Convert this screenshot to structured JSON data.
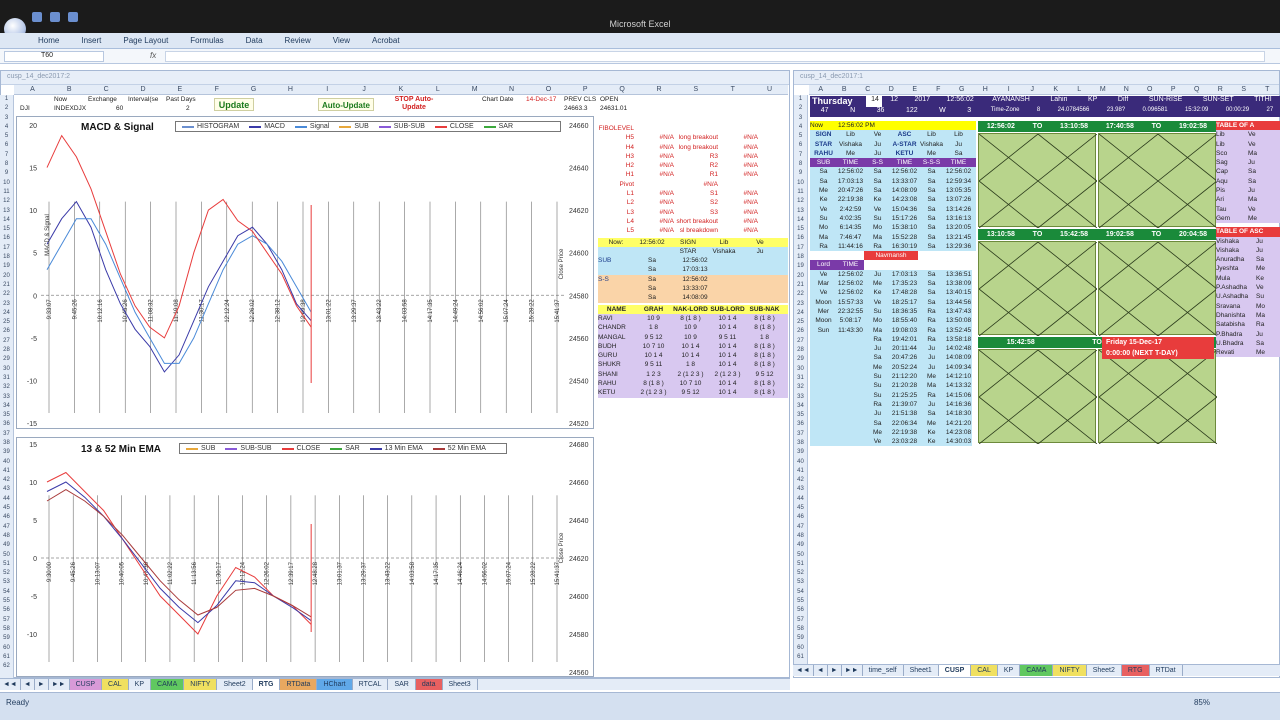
{
  "app": {
    "title": "Microsoft Excel",
    "name_box": "T60",
    "fx_label": "fx",
    "ribbon_tabs": [
      "Home",
      "Insert",
      "Page Layout",
      "Formulas",
      "Data",
      "Review",
      "View",
      "Acrobat"
    ]
  },
  "left_window": {
    "caption": "cusp_14_dec2017:2",
    "columns": [
      "A",
      "B",
      "C",
      "D",
      "E",
      "F",
      "G",
      "H",
      "I",
      "J",
      "K",
      "L",
      "M",
      "N",
      "O",
      "P",
      "Q",
      "R",
      "S",
      "T",
      "U"
    ],
    "header_row": {
      "now": "Now",
      "exchange": "Exchange",
      "interval": "Interval(se",
      "past_days": "Past Days",
      "dji": "DJI",
      "indexdjx": "INDEXDJX",
      "interval_val": "60",
      "past_val": "2",
      "chart_date_label": "Chart Date",
      "chart_date": "14-Dec-17",
      "prev_cls": "PREV CLS",
      "open": "OPEN",
      "prev_cls_val": "24663.3",
      "open_val": "24631.01"
    },
    "buttons": {
      "update": "Update",
      "auto_update": "Auto-Update",
      "stop_auto": "STOP Auto-Update"
    }
  },
  "chart_data": [
    {
      "type": "line",
      "title": "MACD & Signal",
      "legend": [
        "HISTOGRAM",
        "MACD",
        "Signal",
        "SUB",
        "SUB-SUB",
        "CLOSE",
        "SAR"
      ],
      "ylabel": "MACD & Signal",
      "y2label": "Close Price",
      "ylim": [
        -15,
        20
      ],
      "y_ticks": [
        20,
        15,
        10,
        5,
        0,
        -5,
        -10,
        -15
      ],
      "y2lim": [
        24520,
        24660
      ],
      "y2_ticks": [
        24660,
        24640,
        24620,
        24600,
        24580,
        24560,
        24540,
        24520
      ],
      "x_ticks": [
        "9:33:07",
        "9:45:26",
        "10:12:16",
        "10:45:26",
        "11:08:32",
        "11:19:08",
        "11:30:17",
        "12:12:24",
        "12:26:02",
        "12:38:12",
        "12:49:38",
        "13:01:22",
        "13:29:37",
        "13:43:22",
        "14:03:58",
        "14:17:35",
        "14:49:24",
        "14:56:02",
        "15:07:24",
        "15:28:22",
        "15:41:37"
      ],
      "series": [
        {
          "name": "MACD",
          "color": "#3a3aa8",
          "values": [
            6,
            9,
            11,
            8,
            3,
            -1,
            -4,
            -6,
            -9,
            -7,
            -3,
            1,
            4,
            7,
            8,
            6,
            3,
            -1,
            -3
          ]
        },
        {
          "name": "Signal",
          "color": "#4a8ad8",
          "values": [
            3,
            6,
            9,
            9,
            6,
            2,
            -2,
            -5,
            -8,
            -8,
            -5,
            -1,
            3,
            6,
            7,
            6,
            4,
            1,
            -2
          ]
        },
        {
          "name": "CLOSE",
          "color": "#e83c3c",
          "values": [
            24640,
            24655,
            24645,
            24630,
            24610,
            24590,
            24575,
            24565,
            24560,
            24575,
            24600,
            24620,
            24625,
            24615,
            24610,
            24600,
            24590,
            24575,
            24565
          ]
        }
      ]
    },
    {
      "type": "line",
      "title": "13 & 52 Min EMA",
      "legend": [
        "SUB",
        "SUB-SUB",
        "CLOSE",
        "SAR",
        "13 Min EMA",
        "52 Min EMA"
      ],
      "ylabel": "",
      "y2label": "Close Price",
      "ylim": [
        -15,
        15
      ],
      "y_ticks": [
        15,
        10,
        5,
        0,
        -5,
        -10
      ],
      "y2lim": [
        24560,
        24680
      ],
      "y2_ticks": [
        24680,
        24660,
        24640,
        24620,
        24600,
        24580,
        24560
      ],
      "x_ticks": [
        "9:30:00",
        "9:45:26",
        "10:13:07",
        "10:40:05",
        "10:47:36",
        "11:02:22",
        "11:13:56",
        "11:30:17",
        "12:12:24",
        "12:26:02",
        "12:39:17",
        "12:48:28",
        "13:01:37",
        "13:29:37",
        "13:43:22",
        "14:03:58",
        "14:17:35",
        "14:46:24",
        "14:56:02",
        "15:07:24",
        "15:28:22",
        "15:41:37"
      ],
      "series": [
        {
          "name": "CLOSE",
          "color": "#e83c3c",
          "values": [
            24660,
            24665,
            24655,
            24645,
            24630,
            24615,
            24600,
            24590,
            24580,
            24600,
            24615,
            24610,
            24600,
            24595,
            24585
          ]
        },
        {
          "name": "13 Min EMA",
          "color": "#3a3aa8",
          "values": [
            24655,
            24660,
            24652,
            24642,
            24630,
            24617,
            24604,
            24594,
            24586,
            24595,
            24608,
            24607,
            24600,
            24594,
            24587
          ]
        },
        {
          "name": "52 Min EMA",
          "color": "#a83a3a",
          "values": [
            24650,
            24656,
            24650,
            24642,
            24632,
            24620,
            24608,
            24598,
            24590,
            24594,
            24603,
            24604,
            24600,
            24595,
            24589
          ]
        }
      ]
    }
  ],
  "pivot_panel": {
    "rows": [
      {
        "label": "FIBOLEVEL",
        "a": "",
        "b": "",
        "c": ""
      },
      {
        "label": "H5",
        "a": "#N/A",
        "b": "long breakout",
        "c": "#N/A"
      },
      {
        "label": "H4",
        "a": "#N/A",
        "b": "long breakout",
        "c": "#N/A"
      },
      {
        "label": "H3",
        "a": "#N/A",
        "b": "R3",
        "c": "#N/A"
      },
      {
        "label": "H2",
        "a": "#N/A",
        "b": "R2",
        "c": "#N/A"
      },
      {
        "label": "H1",
        "a": "#N/A",
        "b": "R1",
        "c": "#N/A"
      },
      {
        "label": "Pivot",
        "a": "",
        "b": "#N/A",
        "c": ""
      },
      {
        "label": "L1",
        "a": "#N/A",
        "b": "S1",
        "c": "#N/A"
      },
      {
        "label": "L2",
        "a": "#N/A",
        "b": "S2",
        "c": "#N/A"
      },
      {
        "label": "L3",
        "a": "#N/A",
        "b": "S3",
        "c": "#N/A"
      },
      {
        "label": "L4",
        "a": "#N/A",
        "b": "short breakout",
        "c": "#N/A"
      },
      {
        "label": "L5",
        "a": "#N/A",
        "b": "sl breakdown",
        "c": "#N/A"
      }
    ],
    "now_row": {
      "label": "Now:",
      "time": "12:56:02",
      "sign": "SIGN",
      "lib": "Lib",
      "ve": "Ve"
    },
    "star_row": {
      "star": "STAR",
      "vishaka": "Vishaka",
      "ju": "Ju"
    },
    "sub_rows": [
      {
        "label": "SUB",
        "a": "Sa",
        "b": "12:56:02"
      },
      {
        "label": "",
        "a": "Sa",
        "b": "17:03:13"
      },
      {
        "label": "S-S",
        "a": "Sa",
        "b": "12:56:02"
      },
      {
        "label": "",
        "a": "Sa",
        "b": "13:33:07"
      },
      {
        "label": "",
        "a": "Sa",
        "b": "14:08:09"
      }
    ],
    "planet_header": [
      "NAME",
      "GRAH",
      "NAK-LORD",
      "SUB-LORD",
      "SUB-NAK"
    ],
    "planets": [
      [
        "RAVI",
        "10 9",
        "8 (1 8 )",
        "10 1 4",
        "8 (1 8 )"
      ],
      [
        "CHANDR",
        "1 8",
        "10 9",
        "10 1 4",
        "8 (1 8 )"
      ],
      [
        "MANGAL",
        "9 5 12",
        "10 9",
        "9 5 11",
        "1 8"
      ],
      [
        "BUDH",
        "10 7 10",
        "10 1 4",
        "10 1 4",
        "8 (1 8 )"
      ],
      [
        "GURU",
        "10 1 4",
        "10 1 4",
        "10 1 4",
        "8 (1 8 )"
      ],
      [
        "SHUKR",
        "9 5 11",
        "1 8",
        "10 1 4",
        "8 (1 8 )"
      ],
      [
        "SHANI",
        "1 2 3",
        "2 (1 2 3 )",
        "2 (1 2 3 )",
        "9 5 12"
      ],
      [
        "RAHU",
        "8 (1 8 )",
        "10 7 10",
        "10 1 4",
        "8 (1 8 )"
      ],
      [
        "KETU",
        "2 (1 2 3 )",
        "9 5 12",
        "10 1 4",
        "8 (1 8 )"
      ]
    ]
  },
  "left_sheet_tabs": [
    "CUSP",
    "CAL",
    "KP",
    "CAMA",
    "NIFTY",
    "Sheet2",
    "RTG",
    "RTData",
    "HChart",
    "RTCAL",
    "SAR",
    "data",
    "Sheet3"
  ],
  "right_window": {
    "caption": "cusp_14_dec2017:1",
    "columns": [
      "A",
      "B",
      "C",
      "D",
      "E",
      "F",
      "G",
      "H",
      "I",
      "J",
      "K",
      "L",
      "M",
      "N",
      "O",
      "P",
      "Q",
      "R",
      "S",
      "T"
    ],
    "header": {
      "day": "Thursday",
      "d": "14",
      "m": "12",
      "y": "2017",
      "time": "12:56:02",
      "ayanansh": "AYANANSH",
      "lahiri": "Lahiri",
      "kp": "KP",
      "diff": "Diff",
      "sunrise": "SUN-RISE",
      "sunset": "SUN-SET",
      "tithi": "TITHI",
      "lat": "47",
      "n": "N",
      "deg": "36",
      "long": "122",
      "w": "W",
      "tz_val": "3",
      "tz": "Time-Zone",
      "tz_num": "8",
      "lahiri_val": "24.0784566",
      "kp_val": "23.98?",
      "diff_val": "0.096581",
      "sunrise_val": "15:32:09",
      "sunset_val": "00:00:29",
      "tithi_val": "27",
      "now": "Now",
      "now_time": "12:56:02 PM",
      "table_of": "TABLE OF A"
    },
    "sign_block": [
      [
        "SIGN",
        "Lib",
        "Ve",
        "ASC",
        "Lib",
        "Lib"
      ],
      [
        "STAR",
        "Vishaka",
        "Ju",
        "A-STAR",
        "Vishaka",
        "Ju"
      ],
      [
        "RAHU",
        "Me",
        "Ju",
        "KETU",
        "Me",
        "Sa"
      ]
    ],
    "sub_block_header": [
      "SUB",
      "TIME",
      "S-S",
      "TIME",
      "S-S-S",
      "TIME"
    ],
    "sub_block": [
      [
        "Sa",
        "12:56:02",
        "Sa",
        "12:56:02",
        "Sa",
        "12:56:02"
      ],
      [
        "Sa",
        "17:03:13",
        "Sa",
        "13:33:07",
        "Sa",
        "12:59:34"
      ],
      [
        "Me",
        "20:47:26",
        "Sa",
        "14:08:09",
        "Sa",
        "13:05:35"
      ],
      [
        "Ke",
        "22:19:38",
        "Ke",
        "14:23:08",
        "Sa",
        "13:07:26"
      ],
      [
        "Ve",
        "2:42:59",
        "Ve",
        "15:04:36",
        "Sa",
        "13:14:26"
      ],
      [
        "Su",
        "4:02:35",
        "Su",
        "15:17:26",
        "Sa",
        "13:16:13"
      ],
      [
        "Mo",
        "6:14:35",
        "Mo",
        "15:38:10",
        "Sa",
        "13:20:05"
      ],
      [
        "Ma",
        "7:46:47",
        "Ma",
        "15:52:28",
        "Sa",
        "13:21:45"
      ],
      [
        "Ra",
        "11:44:16",
        "Ra",
        "16:30:19",
        "Sa",
        "13:29:36"
      ]
    ],
    "navmansh": "Navmansh",
    "lord_header": [
      "Lord",
      "TIME"
    ],
    "lord_block": [
      [
        "Ve",
        "12:56:02",
        "Ju",
        "17:03:13",
        "Sa",
        "13:36:51"
      ],
      [
        "Mar",
        "12:56:02",
        "Me",
        "17:35:23",
        "Sa",
        "13:38:09"
      ],
      [
        "Ve",
        "12:56:02",
        "Ke",
        "17:48:28",
        "Sa",
        "13:40:15"
      ],
      [
        "Moon",
        "15:57:33",
        "Ve",
        "18:25:17",
        "Sa",
        "13:44:56"
      ],
      [
        "Mer",
        "22:32:55",
        "Su",
        "18:36:35",
        "Ra",
        "13:47:43"
      ],
      [
        "Moon",
        "5:08:17",
        "Mo",
        "18:55:40",
        "Ra",
        "13:50:08"
      ],
      [
        "Sun",
        "11:43:30",
        "Ma",
        "19:08:03",
        "Ra",
        "13:52:45"
      ],
      [
        "",
        "",
        "Ra",
        "19:42:01",
        "Ra",
        "13:58:18"
      ],
      [
        "",
        "",
        "Ju",
        "20:11:44",
        "Ju",
        "14:02:48"
      ],
      [
        "",
        "",
        "Sa",
        "20:47:26",
        "Ju",
        "14:08:09"
      ],
      [
        "",
        "",
        "Me",
        "20:52:24",
        "Ju",
        "14:09:34"
      ],
      [
        "",
        "",
        "Su",
        "21:12:20",
        "Me",
        "14:12:10"
      ],
      [
        "",
        "",
        "Su",
        "21:20:28",
        "Ma",
        "14:13:32"
      ],
      [
        "",
        "",
        "Su",
        "21:25:25",
        "Ra",
        "14:15:06"
      ],
      [
        "",
        "",
        "Ra",
        "21:39:07",
        "Ju",
        "14:16:36"
      ],
      [
        "",
        "",
        "Ju",
        "21:51:38",
        "Sa",
        "14:18:30"
      ],
      [
        "",
        "",
        "Sa",
        "22:06:34",
        "Me",
        "14:21:20"
      ],
      [
        "",
        "",
        "Me",
        "22:19:38",
        "Ke",
        "14:23:08"
      ],
      [
        "",
        "",
        "Ve",
        "23:03:28",
        "Ke",
        "14:30:03"
      ]
    ],
    "kundli_bands": [
      {
        "from": "12:56:02",
        "to_label": "TO",
        "to": "13:10:58",
        "from2": "17:40:58",
        "to2_label": "TO",
        "to2": "19:02:58"
      },
      {
        "from": "13:10:58",
        "to_label": "TO",
        "to": "15:42:58",
        "from2": "19:02:58",
        "to2_label": "TO",
        "to2": "20:04:58"
      },
      {
        "from": "15:42:58",
        "to_label": "TO",
        "to": "17:40:58",
        "friday": "Friday",
        "friday_time": "0:00:00",
        "next_date": "15-Dec-17",
        "next_label": "(NEXT T-DAY)"
      }
    ],
    "table_of_asc": "TABLE OF ASC",
    "right_list": [
      "Lib",
      "Lib",
      "Sco",
      "Sag",
      "Cap",
      "Aqu",
      "Pis",
      "Ari",
      "Tau",
      "Gem"
    ],
    "right_list2": [
      "Ve",
      "Ve",
      "Ma",
      "Ju",
      "Sa",
      "Sa",
      "Ju",
      "Ma",
      "Ve",
      "Me"
    ],
    "asc_list": [
      "Vishaka",
      "Vishaka",
      "Anuradha",
      "Jyeshta",
      "Mula",
      "P.Ashadha",
      "U.Ashadha",
      "Sravana",
      "Dhanishta",
      "Satabisha",
      "P.Bhadra",
      "U.Bhadra",
      "Revati"
    ],
    "asc_list2": [
      "Ju",
      "Ju",
      "Sa",
      "Me",
      "Ke",
      "Ve",
      "Su",
      "Mo",
      "Ma",
      "Ra",
      "Ju",
      "Sa",
      "Me"
    ]
  },
  "right_sheet_tabs": [
    "time_self",
    "Sheet1",
    "CUSP",
    "CAL",
    "KP",
    "CAMA",
    "NIFTY",
    "Sheet2",
    "RTG",
    "RTDat"
  ],
  "status": {
    "ready": "Ready",
    "zoom": "85%"
  }
}
